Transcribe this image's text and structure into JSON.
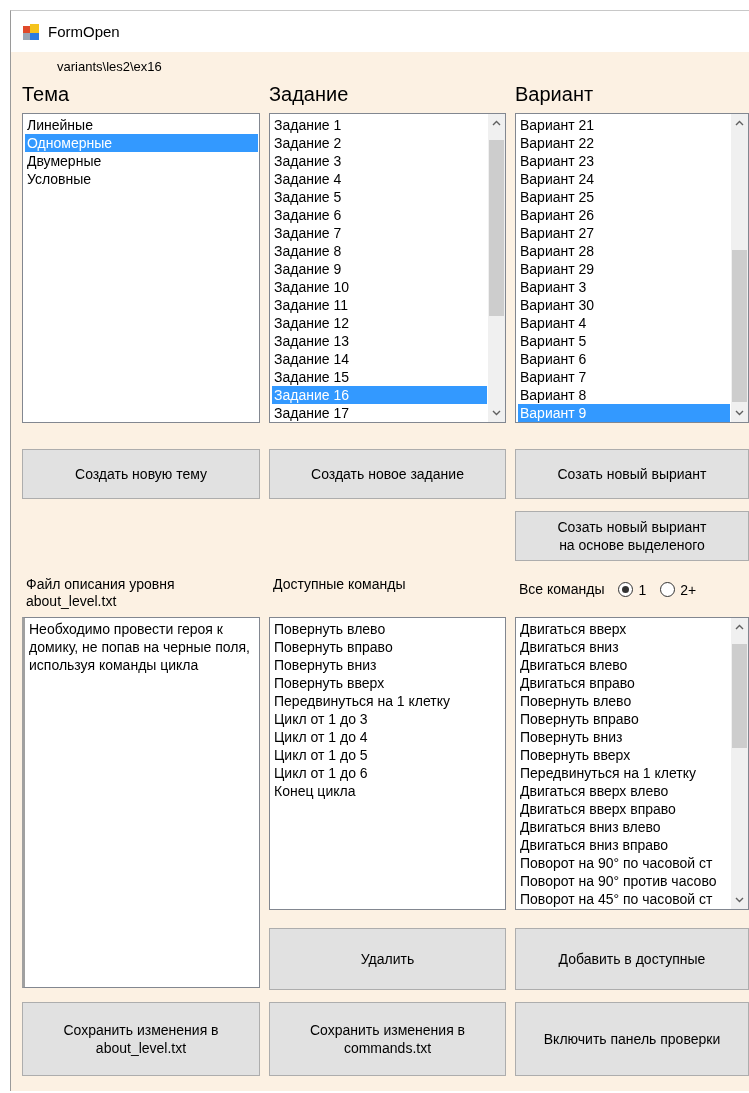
{
  "window": {
    "title": "FormOpen"
  },
  "path": "variants\\les2\\ex16",
  "topic": {
    "heading": "Тема",
    "items": [
      {
        "label": "Линейные",
        "selected": false
      },
      {
        "label": "Одномерные",
        "selected": true
      },
      {
        "label": "Двумерные",
        "selected": false
      },
      {
        "label": "Условные",
        "selected": false
      }
    ],
    "button": "Создать новую тему"
  },
  "task": {
    "heading": "Задание",
    "items": [
      {
        "label": "Задание 1",
        "selected": false
      },
      {
        "label": "Задание 2",
        "selected": false
      },
      {
        "label": "Задание 3",
        "selected": false
      },
      {
        "label": "Задание 4",
        "selected": false
      },
      {
        "label": "Задание 5",
        "selected": false
      },
      {
        "label": "Задание 6",
        "selected": false
      },
      {
        "label": "Задание 7",
        "selected": false
      },
      {
        "label": "Задание 8",
        "selected": false
      },
      {
        "label": "Задание 9",
        "selected": false
      },
      {
        "label": "Задание 10",
        "selected": false
      },
      {
        "label": "Задание 11",
        "selected": false
      },
      {
        "label": "Задание 12",
        "selected": false
      },
      {
        "label": "Задание 13",
        "selected": false
      },
      {
        "label": "Задание 14",
        "selected": false
      },
      {
        "label": "Задание 15",
        "selected": false
      },
      {
        "label": "Задание 16",
        "selected": true
      },
      {
        "label": "Задание 17",
        "selected": false
      }
    ],
    "button": "Создать новое задание"
  },
  "variant": {
    "heading": "Вариант",
    "items": [
      {
        "label": "Вариант 21",
        "selected": false
      },
      {
        "label": "Вариант 22",
        "selected": false
      },
      {
        "label": "Вариант 23",
        "selected": false
      },
      {
        "label": "Вариант 24",
        "selected": false
      },
      {
        "label": "Вариант 25",
        "selected": false
      },
      {
        "label": "Вариант 26",
        "selected": false
      },
      {
        "label": "Вариант 27",
        "selected": false
      },
      {
        "label": "Вариант 28",
        "selected": false
      },
      {
        "label": "Вариант 29",
        "selected": false
      },
      {
        "label": "Вариант 3",
        "selected": false
      },
      {
        "label": "Вариант 30",
        "selected": false
      },
      {
        "label": "Вариант 4",
        "selected": false
      },
      {
        "label": "Вариант 5",
        "selected": false
      },
      {
        "label": "Вариант 6",
        "selected": false
      },
      {
        "label": "Вариант 7",
        "selected": false
      },
      {
        "label": "Вариант 8",
        "selected": false
      },
      {
        "label": "Вариант 9",
        "selected": true
      }
    ],
    "button": "Созать новый выриант",
    "button_based": [
      "Созать новый выриант",
      "на основе выделеного"
    ]
  },
  "level_file": {
    "label": [
      "Файл описания уровня",
      "about_level.txt"
    ],
    "text": "Необходимо провести героя к домику, не попав на черные поля, используя команды цикла",
    "save_button": [
      "Сохранить изменения в",
      "about_level.txt"
    ]
  },
  "available": {
    "label": "Доступные команды",
    "items": [
      "Повернуть влево",
      "Повернуть вправо",
      "Повернуть вниз",
      "Повернуть вверх",
      "Передвинуться на 1 клетку",
      "Цикл от 1 до 3",
      "Цикл от 1 до 4",
      "Цикл от 1 до 5",
      "Цикл от 1 до 6",
      "Конец цикла"
    ],
    "delete_button": "Удалить",
    "save_button": [
      "Сохранить изменения в",
      "commands.txt"
    ]
  },
  "all_commands": {
    "label": "Все команды",
    "options": [
      {
        "label": "1",
        "selected": true
      },
      {
        "label": "2+",
        "selected": false
      }
    ],
    "items": [
      "Двигаться вверх",
      "Двигаться вниз",
      "Двигаться влево",
      "Двигаться вправо",
      "Повернуть влево",
      "Повернуть вправо",
      "Повернуть вниз",
      "Повернуть вверх",
      "Передвинуться на 1 клетку",
      "Двигаться вверх влево",
      "Двигаться вверх вправо",
      "Двигаться вниз влево",
      "Двигаться вниз вправо",
      "Поворот на 90° по часовой ст",
      "Поворот на 90° против часово",
      "Поворот на 45° по часовой ст"
    ],
    "add_button": "Добавить в доступные",
    "check_button": "Включить панель проверки"
  }
}
